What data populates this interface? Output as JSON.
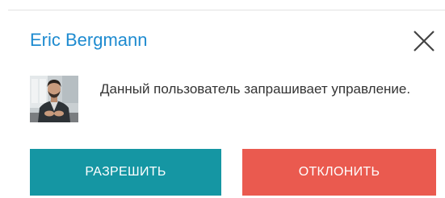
{
  "dialog": {
    "title": "Eric Bergmann",
    "message": "Данный пользователь запрашивает управление.",
    "close_icon": "close-icon",
    "avatar_icon": "user-avatar",
    "buttons": {
      "allow_label": "РАЗРЕШИТЬ",
      "deny_label": "ОТКЛОНИТЬ"
    }
  },
  "colors": {
    "title": "#1e8bd0",
    "allow": "#1596a3",
    "deny": "#ea5a4f",
    "text": "#333333"
  }
}
